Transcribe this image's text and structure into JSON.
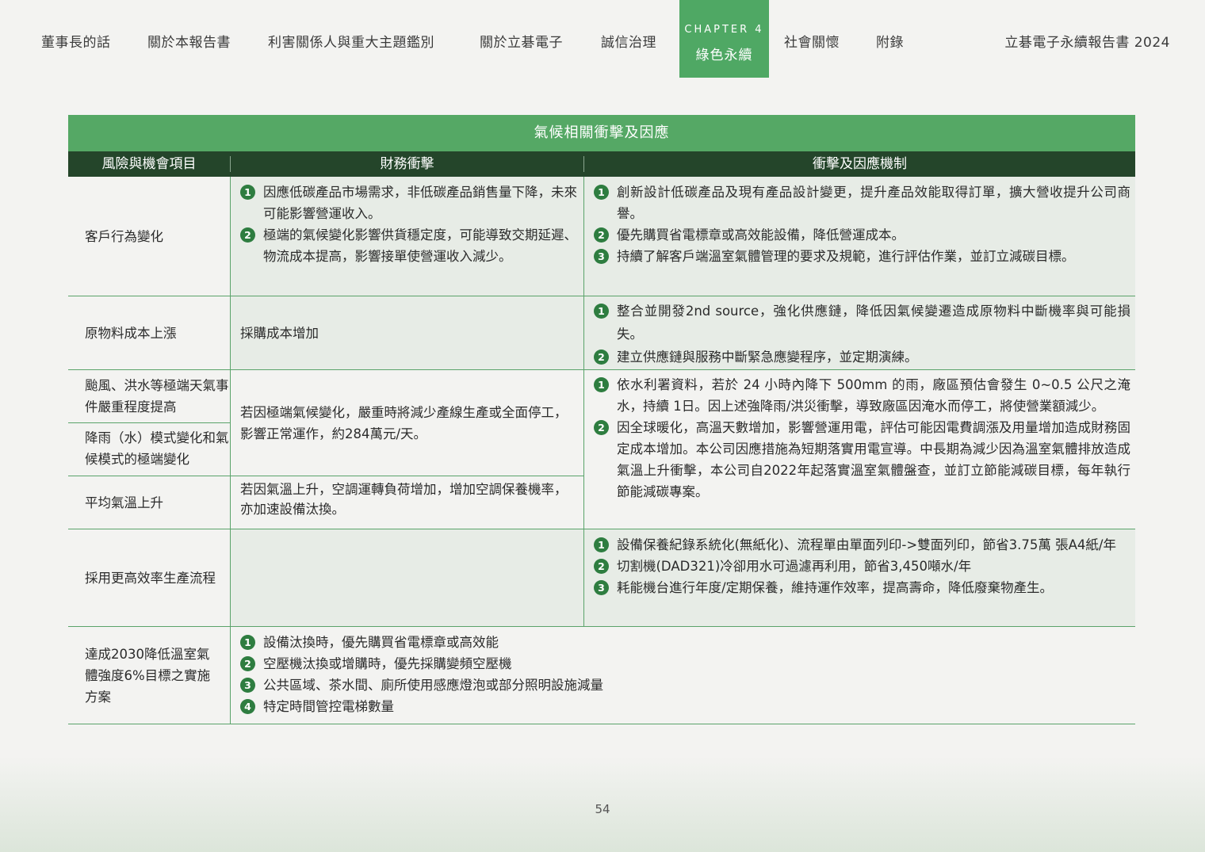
{
  "nav": {
    "items": [
      "董事長的話",
      "關於本報告書",
      "利害關係人與重大主題鑑別",
      "關於立碁電子",
      "誠信治理",
      "社會關懷",
      "附錄"
    ],
    "chapter_label": "CHAPTER 4",
    "chapter_title": "綠色永續",
    "report_title": "立碁電子永續報告書 2024"
  },
  "table": {
    "title": "氣候相關衝擊及因應",
    "headers": [
      "風險與機會項目",
      "財務衝擊",
      "衝擊及因應機制"
    ],
    "rows": [
      {
        "item": "客戶行為變化",
        "financial": [
          "因應低碳產品市場需求，非低碳產品銷售量下降，未來可能影響營運收入。",
          "極端的氣候變化影響供貨穩定度，可能導致交期延遲、物流成本提高，影響接單使營運收入減少。"
        ],
        "response": [
          "創新設計低碳產品及現有產品設計變更，提升產品效能取得訂單，擴大營收提升公司商譽。",
          "優先購買省電標章或高效能設備，降低營運成本。",
          "持續了解客戶端溫室氣體管理的要求及規範，進行評估作業，並訂立減碳目標。"
        ]
      },
      {
        "item": "原物料成本上漲",
        "financial_text": "採購成本增加",
        "response": [
          "整合並開發2nd source，強化供應鏈，降低因氣候變遷造成原物料中斷機率與可能損失。",
          "建立供應鏈與服務中斷緊急應變程序，並定期演練。"
        ]
      },
      {
        "items": [
          "颱風、洪水等極端天氣事件嚴重程度提高",
          "降雨（水）模式變化和氣候模式的極端變化",
          "平均氣溫上升"
        ],
        "financial_texts": [
          "若因極端氣候變化，嚴重時將減少產線生產或全面停工，影響正常運作，約284萬元/天。",
          "若因氣溫上升，空調運轉負荷增加，增加空調保養機率，亦加速設備汰換。"
        ],
        "response": [
          "依水利署資料，若於 24 小時內降下 500mm 的雨，廠區預估會發生 0~0.5 公尺之淹水，持續 1日。因上述強降雨/洪災衝擊，導致廠區因淹水而停工，將使營業額減少。",
          "因全球暖化，高溫天數增加，影響營運用電，評估可能因電費調漲及用量增加造成財務固定成本增加。本公司因應措施為短期落實用電宣導。中長期為減少因為溫室氣體排放造成氣溫上升衝擊，本公司自2022年起落實溫室氣體盤查，並訂立節能減碳目標，每年執行節能減碳專案。"
        ]
      },
      {
        "item": "採用更高效率生產流程",
        "response": [
          "設備保養紀錄系統化(無紙化)、流程單由單面列印->雙面列印，節省3.75萬 張A4紙/年",
          "切割機(DAD321)冷卻用水可過濾再利用，節省3,450噸水/年",
          "耗能機台進行年度/定期保養，維持運作效率，提高壽命，降低廢棄物產生。"
        ]
      },
      {
        "item": "達成2030降低溫室氣體強度6%目標之實施方案",
        "plans": [
          "設備汰換時，優先購買省電標章或高效能",
          "空壓機汰換或增購時，優先採購變頻空壓機",
          "公共區域、茶水間、廁所使用感應燈泡或部分照明設施減量",
          "特定時間管控電梯數量"
        ]
      }
    ]
  },
  "page_number": "54"
}
